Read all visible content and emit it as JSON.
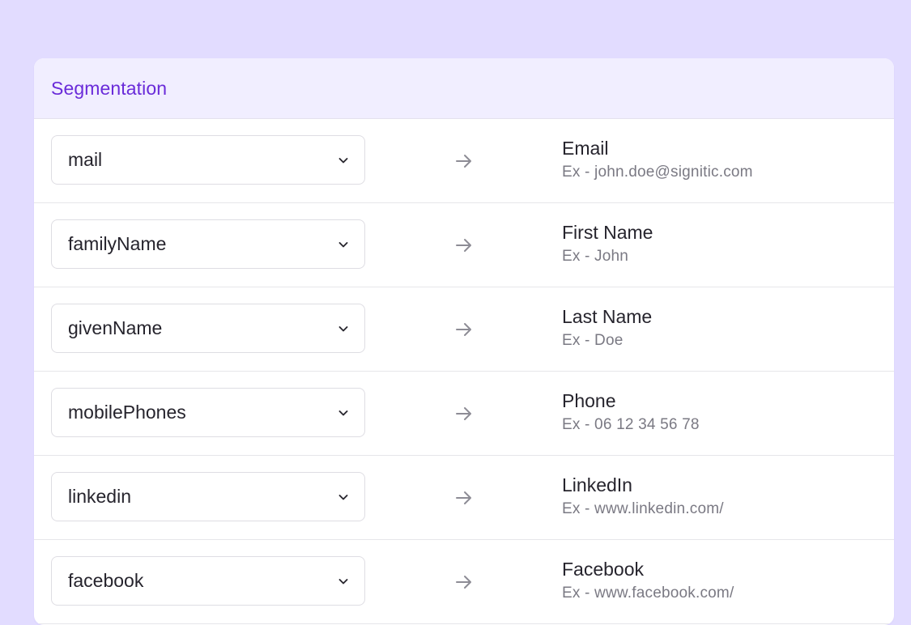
{
  "card": {
    "title": "Segmentation"
  },
  "colors": {
    "background": "#e2dcff",
    "header_background": "#f1eeff",
    "accent": "#6a2bd9"
  },
  "mappings": [
    {
      "source": "mail",
      "target": "Email",
      "example": "Ex - john.doe@signitic.com"
    },
    {
      "source": "familyName",
      "target": "First Name",
      "example": "Ex - John"
    },
    {
      "source": "givenName",
      "target": "Last Name",
      "example": "Ex - Doe"
    },
    {
      "source": "mobilePhones",
      "target": "Phone",
      "example": "Ex - 06 12 34 56 78"
    },
    {
      "source": "linkedin",
      "target": "LinkedIn",
      "example": "Ex - www.linkedin.com/"
    },
    {
      "source": "facebook",
      "target": "Facebook",
      "example": "Ex - www.facebook.com/"
    }
  ],
  "icons": {
    "dropdown": "chevron-down-icon",
    "mapping": "arrow-right-icon"
  }
}
